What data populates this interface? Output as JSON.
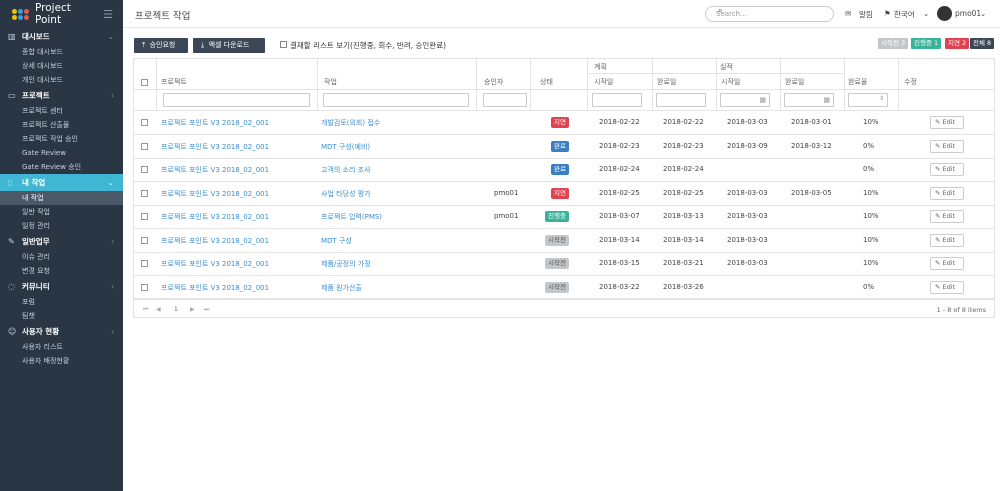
{
  "app": {
    "name": "Project Point",
    "page_title": "프로젝트 작업"
  },
  "colors": {
    "sidebar": "#2a3644",
    "active": "#3fb6d4",
    "link": "#3a8fd1",
    "red": "#e0434f",
    "blue": "#3a7fc4",
    "green": "#3bb39a",
    "gray": "#c4c7ca"
  },
  "header": {
    "search_placeholder": "Search...",
    "alerts": "알림",
    "language": "한국어",
    "user": "pmo01"
  },
  "sidebar": {
    "sections": [
      {
        "label": "대시보드",
        "icon": "bar-chart-icon",
        "items": [
          "종합 대시보드",
          "상세 대시보드",
          "개인 대시보드"
        ]
      },
      {
        "label": "프로젝트",
        "icon": "monitor-icon",
        "items": [
          "프로젝트 센터",
          "프로젝트 산출물",
          "프로젝트 작업 승인",
          "Gate Review",
          "Gate Review 승인"
        ]
      },
      {
        "label": "내 작업",
        "icon": "document-icon",
        "items": [
          "내 작업",
          "일반 작업",
          "일정 관리"
        ]
      },
      {
        "label": "일반업무",
        "icon": "edit-icon",
        "items": [
          "이슈 관리",
          "변경 요청"
        ]
      },
      {
        "label": "커뮤니티",
        "icon": "chat-icon",
        "items": [
          "포럼",
          "팀챗"
        ]
      },
      {
        "label": "사용자 현황",
        "icon": "users-icon",
        "items": [
          "사용자 리스트",
          "사용자 배정현황"
        ]
      }
    ]
  },
  "toolbar": {
    "approve_button": "승인요청",
    "excel_button": "엑셀 다운로드",
    "checkbox_label": "결재할 리스트 보기(진행중, 회수, 반려, 승인완료)"
  },
  "status_counts": [
    {
      "label": "시작전",
      "count": "3"
    },
    {
      "label": "진행중",
      "count": "1"
    },
    {
      "label": "지연",
      "count": "2"
    },
    {
      "label": "전체",
      "count": "8"
    }
  ],
  "table": {
    "headers": {
      "project": "프로젝트",
      "task": "작업",
      "approver": "승인자",
      "status": "상태",
      "plan": "계획",
      "actual": "실적",
      "start": "시작일",
      "end": "완료일",
      "progress": "완료율",
      "modify": "수정"
    },
    "rows": [
      {
        "project": "프로젝트 포인트 V3 2018_02_001",
        "task": "개발검토(외회) 접수",
        "approver": "",
        "status": "지연",
        "plan_start": "2018-02-22",
        "plan_end": "2018-02-22",
        "act_start": "2018-03-03",
        "act_end": "2018-03-01",
        "progress": "10%"
      },
      {
        "project": "프로젝트 포인트 V3 2018_02_001",
        "task": "MDT 구성(예비)",
        "approver": "",
        "status": "완료",
        "plan_start": "2018-02-23",
        "plan_end": "2018-02-23",
        "act_start": "2018-03-09",
        "act_end": "2018-03-12",
        "progress": "0%"
      },
      {
        "project": "프로젝트 포인트 V3 2018_02_001",
        "task": "고객의 소리 조사",
        "approver": "",
        "status": "완료",
        "plan_start": "2018-02-24",
        "plan_end": "2018-02-24",
        "act_start": "",
        "act_end": "",
        "progress": "0%"
      },
      {
        "project": "프로젝트 포인트 V3 2018_02_001",
        "task": "사업 타당성 평가",
        "approver": "pmo01",
        "status": "지연",
        "plan_start": "2018-02-25",
        "plan_end": "2018-02-25",
        "act_start": "2018-03-03",
        "act_end": "2018-03-05",
        "progress": "10%"
      },
      {
        "project": "프로젝트 포인트 V3 2018_02_001",
        "task": "프로젝트 입력(PMS)",
        "approver": "pmo01",
        "status": "진행중",
        "plan_start": "2018-03-07",
        "plan_end": "2018-03-13",
        "act_start": "2018-03-03",
        "act_end": "",
        "progress": "10%"
      },
      {
        "project": "프로젝트 포인트 V3 2018_02_001",
        "task": "MDT 구성",
        "approver": "",
        "status": "시작전",
        "plan_start": "2018-03-14",
        "plan_end": "2018-03-14",
        "act_start": "2018-03-03",
        "act_end": "",
        "progress": "10%"
      },
      {
        "project": "프로젝트 포인트 V3 2018_02_001",
        "task": "제품/공정의 가정",
        "approver": "",
        "status": "시작전",
        "plan_start": "2018-03-15",
        "plan_end": "2018-03-21",
        "act_start": "2018-03-03",
        "act_end": "",
        "progress": "10%"
      },
      {
        "project": "프로젝트 포인트 V3 2018_02_001",
        "task": "제품 원가산출",
        "approver": "",
        "status": "시작전",
        "plan_start": "2018-03-22",
        "plan_end": "2018-03-26",
        "act_start": "",
        "act_end": "",
        "progress": "0%"
      }
    ],
    "edit_label": "Edit"
  },
  "pager": {
    "current": "1",
    "summary": "1 - 8 of 8 items"
  }
}
